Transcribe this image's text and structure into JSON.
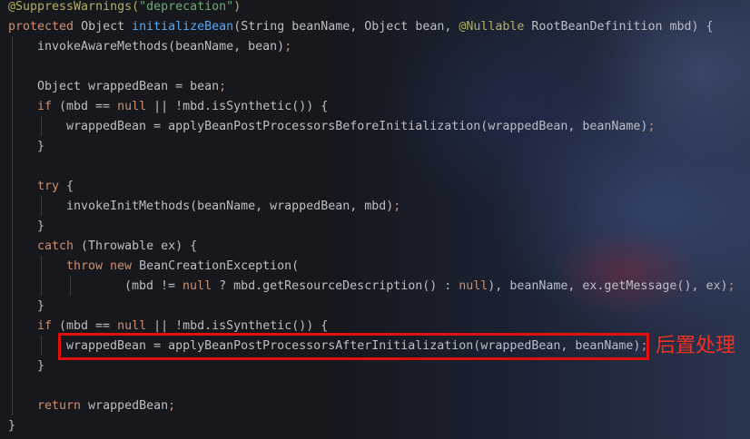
{
  "editor": {
    "lines": [
      {
        "indent": 0,
        "tokens": [
          {
            "t": "@SuppressWarnings(",
            "c": "ann"
          },
          {
            "t": "\"deprecation\"",
            "c": "str"
          },
          {
            "t": ")",
            "c": "ann"
          }
        ]
      },
      {
        "indent": 0,
        "tokens": [
          {
            "t": "protected",
            "c": "kw"
          },
          {
            "t": " Object "
          },
          {
            "t": "initializeBean",
            "c": "fn"
          },
          {
            "t": "(String beanName, Object bean, "
          },
          {
            "t": "@Nullable",
            "c": "ann"
          },
          {
            "t": " RootBeanDefinition mbd) {"
          }
        ]
      },
      {
        "indent": 1,
        "tokens": [
          {
            "t": "invokeAwareMethods(beanName, bean)"
          },
          {
            "t": ";",
            "c": "kw"
          }
        ]
      },
      {
        "indent": 1,
        "tokens": []
      },
      {
        "indent": 1,
        "tokens": [
          {
            "t": "Object wrappedBean = bean"
          },
          {
            "t": ";",
            "c": "kw"
          }
        ]
      },
      {
        "indent": 1,
        "tokens": [
          {
            "t": "if",
            "c": "kw"
          },
          {
            "t": " (mbd == "
          },
          {
            "t": "null",
            "c": "kw"
          },
          {
            "t": " || !mbd.isSynthetic()) {"
          }
        ]
      },
      {
        "indent": 2,
        "tokens": [
          {
            "t": "wrappedBean = applyBeanPostProcessorsBeforeInitialization(wrappedBean, beanName)"
          },
          {
            "t": ";",
            "c": "kw"
          }
        ]
      },
      {
        "indent": 1,
        "tokens": [
          {
            "t": "}"
          }
        ]
      },
      {
        "indent": 1,
        "tokens": []
      },
      {
        "indent": 1,
        "tokens": [
          {
            "t": "try",
            "c": "kw"
          },
          {
            "t": " {"
          }
        ]
      },
      {
        "indent": 2,
        "tokens": [
          {
            "t": "invokeInitMethods(beanName, wrappedBean, mbd)"
          },
          {
            "t": ";",
            "c": "kw"
          }
        ]
      },
      {
        "indent": 1,
        "tokens": [
          {
            "t": "}"
          }
        ]
      },
      {
        "indent": 1,
        "tokens": [
          {
            "t": "catch",
            "c": "kw"
          },
          {
            "t": " (Throwable ex) {"
          }
        ]
      },
      {
        "indent": 2,
        "tokens": [
          {
            "t": "throw new",
            "c": "kw"
          },
          {
            "t": " BeanCreationException("
          }
        ]
      },
      {
        "indent": 4,
        "tokens": [
          {
            "t": "(mbd != "
          },
          {
            "t": "null",
            "c": "kw"
          },
          {
            "t": " ? mbd.getResourceDescription() : "
          },
          {
            "t": "null",
            "c": "kw"
          },
          {
            "t": "), beanName, ex.getMessage(), ex)"
          },
          {
            "t": ";",
            "c": "kw"
          }
        ]
      },
      {
        "indent": 1,
        "tokens": [
          {
            "t": "}"
          }
        ]
      },
      {
        "indent": 1,
        "tokens": [
          {
            "t": "if",
            "c": "kw"
          },
          {
            "t": " (mbd == "
          },
          {
            "t": "null",
            "c": "kw"
          },
          {
            "t": " || !mbd.isSynthetic()) {"
          }
        ]
      },
      {
        "indent": 2,
        "tokens": [
          {
            "t": "wrappedBean = applyBeanPostProcessorsAfterInitialization(wrappedBean, beanName)"
          },
          {
            "t": ";",
            "c": "kw"
          }
        ]
      },
      {
        "indent": 1,
        "tokens": [
          {
            "t": "}"
          }
        ]
      },
      {
        "indent": 1,
        "tokens": []
      },
      {
        "indent": 1,
        "tokens": [
          {
            "t": "return",
            "c": "kw"
          },
          {
            "t": " wrappedBean"
          },
          {
            "t": ";",
            "c": "kw"
          }
        ]
      },
      {
        "indent": 0,
        "tokens": [
          {
            "t": "}"
          }
        ]
      }
    ]
  },
  "annotation": {
    "note": "后置处理",
    "highlight_color": "#e0100e",
    "note_color": "#f03024"
  },
  "colors": {
    "keyword": "#cf8e6d",
    "function": "#56a8f5",
    "annotation": "#b3ae60",
    "string": "#6aab73",
    "text": "#bcbec4"
  }
}
